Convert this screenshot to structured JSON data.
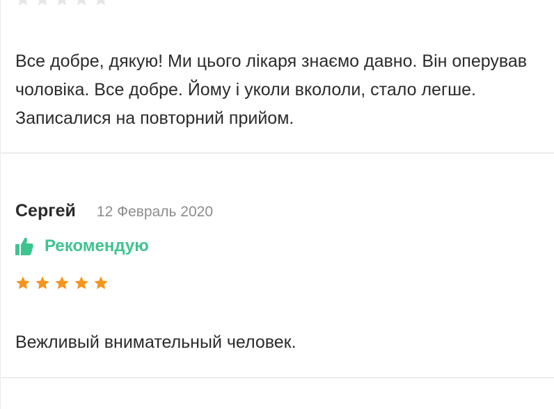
{
  "colors": {
    "star_filled": "#f7941d",
    "star_empty": "#e6e6e6",
    "recommend_green": "#3ec48f",
    "text": "#2b2b2b",
    "date": "#8c8c8c",
    "divider": "#ececec"
  },
  "reviews": [
    {
      "rating_stars_visible": 5,
      "text": "Все добре, дякую! Ми цього лікаря знаємо давно. Він оперував чоловіка. Все добре. Йому і уколи вкололи, стало легше. Записалися на повторний прийом."
    },
    {
      "author": "Сергей",
      "date": "12 Февраль 2020",
      "recommend_icon": "thumbs-up-icon",
      "recommend_label": "Рекомендую",
      "rating": 5,
      "text": "Вежливый внимательный человек."
    }
  ],
  "icons": {
    "star": "star-icon",
    "thumb": "thumbs-up-icon"
  }
}
